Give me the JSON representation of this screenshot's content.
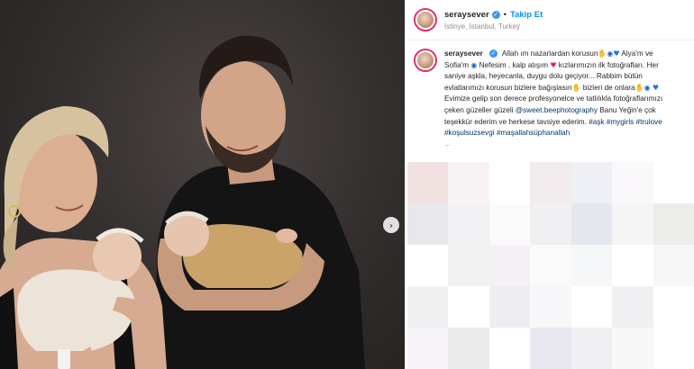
{
  "header": {
    "username": "seraysever",
    "follow_label": "Takip Et",
    "location": "İstinye, İstanbul, Turkey"
  },
  "caption": {
    "username": "seraysever",
    "t1": "Allah ım nazarlardan korusun",
    "t2": "Alya'm ve Sofia'm",
    "t3": "Nefesim , kalp atışım",
    "t4": "kızlarımızın ilk fotoğrafları. Her saniye aşkla, heyecanla, duygu dolu geçiyor... Rabbim bütün evlatlarımızı korusun bizlere bağışlasın",
    "t5": "bizleri de onlara",
    "t6": "Evimize gelip son derece profesyonelce ve tatlılıkla fotoğraflarımızı çeken güzeller güzeli",
    "mention": "@sweet.beephotography",
    "t7": "Banu Yeğin'e çok teşekkür ederim ve herkese tavsiye ederim.",
    "hashtags": [
      "#aşk",
      "#mygirls",
      "#trulove",
      "#koşulsuzsevgi",
      "#maşallahsüphanallah"
    ],
    "more": "..."
  },
  "icons": {
    "verified": "verified-badge-icon",
    "next": "chevron-right-icon",
    "pray": "praying-hands-emoji",
    "eye": "evil-eye-emoji",
    "heart": "heart-emoji"
  },
  "colors": {
    "accent": "#0095f6",
    "hashtag": "#00376b",
    "verified": "#3897f0"
  }
}
